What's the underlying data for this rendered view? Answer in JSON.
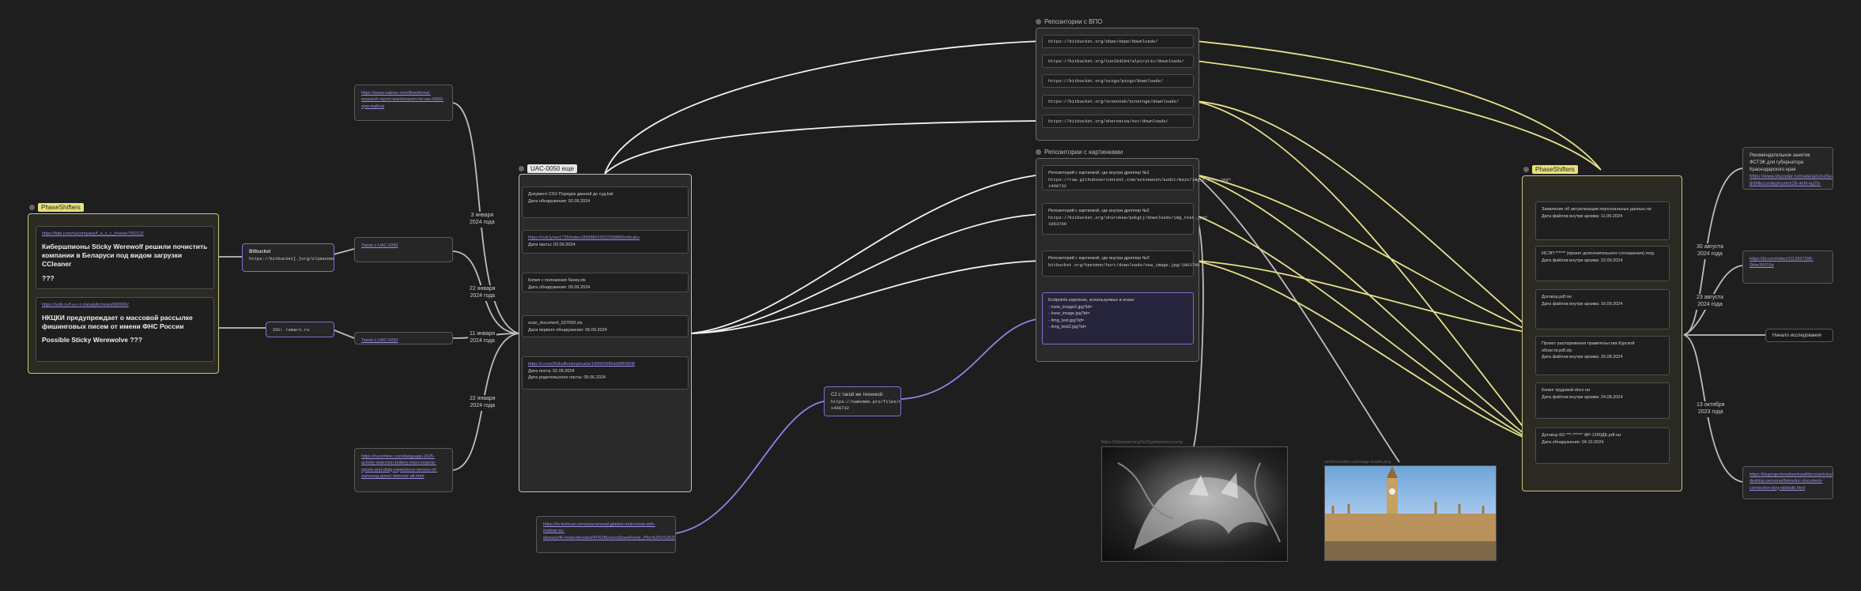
{
  "groups": {
    "left": {
      "label": "PhaseShifters"
    },
    "main": {
      "label": "UAC-0050 еще"
    },
    "vpo": {
      "label": "Репозитории с ВПО"
    },
    "pics": {
      "label": "Репозитории с картинками"
    },
    "right": {
      "label": "PhaseShifters"
    }
  },
  "left": {
    "news1": {
      "link": "https://fabi.com/ru/company/f_a_c_c_t/news/750212/",
      "headline": "Кибершпионы Sticky Werewolf решили почистить компании в Беларуси под видом загрузки CCleaner",
      "q": "???"
    },
    "news2": {
      "link": "https://safe.ru/f-a-c-c-t/analytic/news/800000/",
      "headline": "НКЦКИ предупреждает о массовой рассылке фишинговых писем от имени ФНС России",
      "extra": "Possible Sticky Werewolve ???"
    },
    "bitbucket": {
      "title": "Bitbucket",
      "url": "https://bitbucket[.]org/olimanomo/olimanomo/downloads"
    },
    "ioc": {
      "text": "IOC: remarn.ru"
    }
  },
  "links": {
    "top": "https://www.oalinsn.com/8ws/threat-research-report-team/reason-ml-uac-0050-spw-mallcat",
    "tweet1": "Tweet o UAC-0050",
    "tweet2": "Tweet o UAC-0050",
    "bottom": "https://rucomtrec.com/language-2025-activity-detection-boltery-intercompete-sports-and-dialg-experience-service-of-samsung-green-detector-all-html",
    "bottom2": "https://lo-fontrust.com/ulacos/read-gbetton-telecomal-with-malwar-uc-alonsos/f6-/main/devoted/ATR2Bsssocit2seeRome_Pfsc%20v%20202%20Ao%20BamsCore/%2Dseg/Cor%20%20w%20v%20"
  },
  "edge_labels": {
    "e1": [
      "3 января",
      "2024 года"
    ],
    "e2": [
      "22 января",
      "2024 года"
    ],
    "e3": [
      "11 января",
      "2024 года"
    ],
    "e4": [
      "22 января",
      "2024 года"
    ],
    "r1": [
      "30 августа",
      "2024 года"
    ],
    "r2": [
      "23 августа",
      "2024 года"
    ],
    "r3": [
      "13 октября",
      "2023 года"
    ]
  },
  "main": {
    "cards": [
      {
        "title": "Документ CSV Порядок данной до суд.bat",
        "meta": "Дата обнаружения: 02.09.2024"
      },
      {
        "title": "https://cutt.ly/aw1735/tsdse185888015522258880mibraku",
        "meta": "Дата пасты: 02.09.2024",
        "is_link": true
      },
      {
        "title": "Копия с положения банку.xls",
        "meta": "Дата обнаружения: 09.09.2024"
      },
      {
        "title": "scan_document_027659.xls",
        "meta": "Дата первого обнаружения: 06.09.2024"
      },
      {
        "title": "https://i.com/2k/bulltonk/uploads/100600986dd9866808",
        "meta": "Дата поста: 02.09.2024",
        "meta2": "Дата родительского пасты: 09.06.2024",
        "is_link": true
      }
    ]
  },
  "vpo": {
    "repos": [
      "https://bitbucket.org/ebpe/ebpe/downloads/",
      "https://bitbucket.org/tun204204/alpirytic/downloads/",
      "https://bitbucket.org/ozzgo/pzzgo/downloads/",
      "https://bitbucket.org/ocneovok/ocnetnge/downloads/",
      "https://bitbucket.org/sherestoa/ssr/downloads/"
    ]
  },
  "pics": {
    "repos": [
      {
        "title": "Репозиторий с картинкой, где внутри дроппер №1",
        "url": "https://raw.githubusercontent.com/sotnewssn/audit/main/img_t_ost_.jpg?1466732"
      },
      {
        "title": "Репозиторий с картинкой, где внутри дроппер №2",
        "url": "https://bitbucket.org/shirukew/pokgtj/downloads/img_test.jpg?1063709"
      },
      {
        "title": "Репозиторий с картинкой, где внутри дроппер №3",
        "url": "bitbucket.org/hpetmnn/hurt/downloads/new_image.jpg/1063709"
      }
    ],
    "endpoints": {
      "title": "Endpoints картинок, используемых в атаке:",
      "items": [
        "- /new_image2.jpg?id=",
        "- /new_image.jpg?id=",
        "- /img_test.jpg?id=",
        "- /img_test2.jpg?id="
      ]
    }
  },
  "c2": {
    "title": "C2 с такой же техникой:",
    "url": "https://namomde.pro/files/new_image.jpg?1466732"
  },
  "images": {
    "wolf": {
      "caption": "https://bitbucket.org/2e32gnhb/iamnor.png"
    },
    "london": {
      "caption": "sentincleabm-ua/image-loader.png"
    }
  },
  "right": {
    "cards": [
      {
        "title": "Заявление об актуализации персональных данных.rar",
        "meta": "Дата файлов внутри архива: 11.09.2024"
      },
      {
        "title": "ИСЭП ****** (проект дополнительного соглашения).msg",
        "meta": "Дата файлов внутри архива: 22.09.2024"
      },
      {
        "title": "Договор.pdf.rar",
        "meta": "Дата файлов внутри архива: 16.09.2024"
      },
      {
        "title": "Проект распоряжения правительства Курской области.pdf.zip",
        "meta": "Дата файлов внутри архива: 26.08.2024"
      },
      {
        "title": "Копия трудовой.docx.rar",
        "meta": "Дата файлов внутри архива: 24.08.2024"
      },
      {
        "title": "Договор КО ***-****** ФР-1290ДБ.pdf.rar",
        "meta": "Дата обнаружения: 04.10.2024"
      }
    ],
    "recommend": {
      "text": "Рекомендательное занятие ФСТЭК для губернатора Краснодарского края",
      "link": "https://www.ktscoder.ru/materials/iso5e-dr9/tkcusnlep/surkrj/28-ikrhl-kg7d-8b7b-sss11c86ff9fdk.pdf"
    },
    "mid_link": "https://bl.com/video/1113927396-2bbe26015a",
    "investigate": "Начало исследования",
    "bottom_link": "https://bluprojectorsdownload/docs/articles/trick-desktop-personal/bioreduc-document-connection-ktnj-xkbfadb.html"
  },
  "colors": {
    "bg": "#1e1e1e",
    "yellow_edge": "#e6e08a",
    "purple_edge": "#8f82e8",
    "white_edge": "#f0f0f0",
    "gray_edge": "#bdbdbd"
  }
}
